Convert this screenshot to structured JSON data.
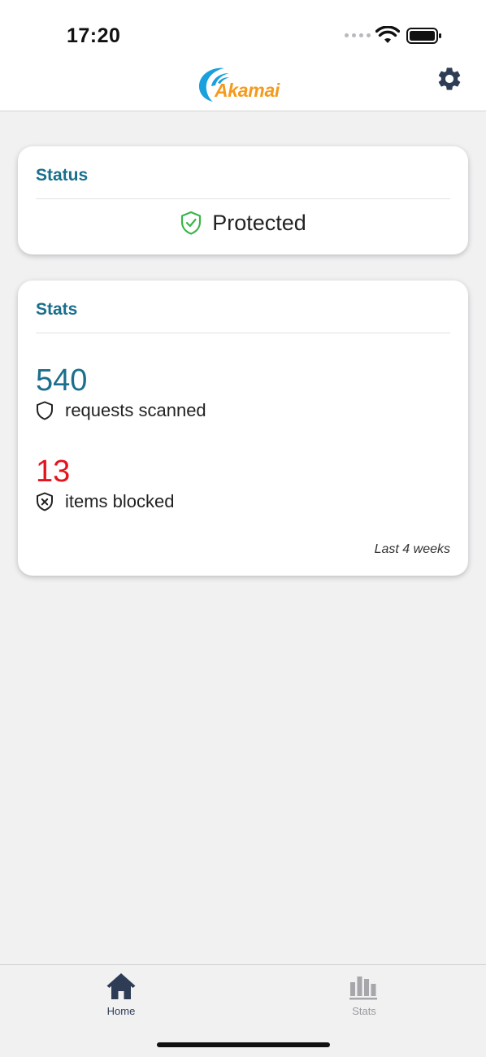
{
  "status_bar": {
    "time": "17:20",
    "icons": [
      "cellular-signal-icon",
      "wifi-icon",
      "battery-icon"
    ]
  },
  "header": {
    "logo_text": "Akamai",
    "settings_icon": "gear-icon"
  },
  "status_card": {
    "title": "Status",
    "status_icon": "shield-check-icon",
    "status_text": "Protected"
  },
  "stats_card": {
    "title": "Stats",
    "items": [
      {
        "value": "540",
        "icon": "shield-outline-icon",
        "label": "requests scanned"
      },
      {
        "value": "13",
        "icon": "shield-x-icon",
        "label": "items blocked"
      }
    ],
    "period": "Last 4 weeks"
  },
  "tab_bar": {
    "tabs": [
      {
        "label": "Home",
        "icon": "home-icon",
        "active": true
      },
      {
        "label": "Stats",
        "icon": "bar-chart-icon",
        "active": false
      }
    ]
  },
  "colors": {
    "accent": "#186f8d",
    "blocked": "#e3141e",
    "protected_icon": "#3ab54a",
    "logo_orange": "#f59a1b",
    "logo_blue": "#1aa0dc",
    "icon_dark": "#2e3d55",
    "inactive": "#9a9a9e",
    "background": "#f1f1f2"
  }
}
